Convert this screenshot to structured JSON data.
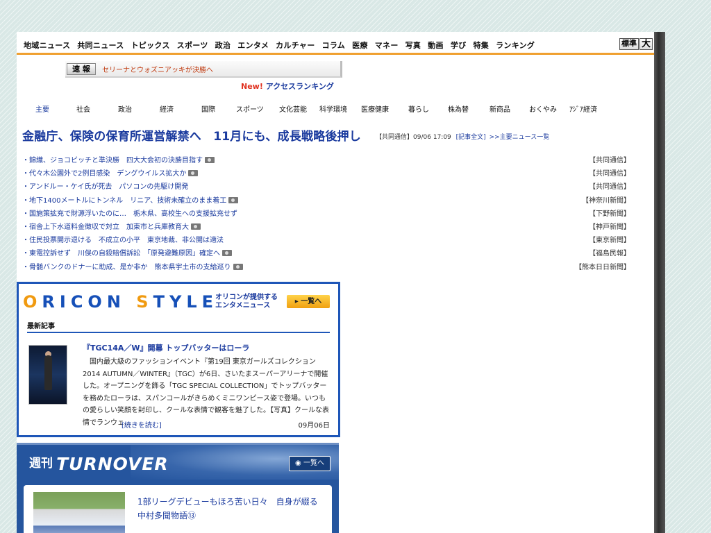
{
  "global_nav": [
    "地域ニュース",
    "共同ニュース",
    "トピックス",
    "スポーツ",
    "政治",
    "エンタメ",
    "カルチャー",
    "コラム",
    "医療",
    "マネー",
    "写真",
    "動画",
    "学び",
    "特集",
    "ランキング"
  ],
  "font_size": {
    "standard": "標準",
    "large": "大"
  },
  "breaking": {
    "label": "速 報",
    "text": "セリーナとウォズニアッキが決勝へ"
  },
  "access_ranking": {
    "new": "New!",
    "label": "アクセスランキング"
  },
  "categories": [
    "主要",
    "社会",
    "政治",
    "経済",
    "国際",
    "スポーツ",
    "文化芸能",
    "科学環境",
    "医療健康",
    "暮らし",
    "株為替",
    "新商品",
    "おくやみ",
    "ｱｼﾞｱ経済"
  ],
  "top_story": {
    "headline": "金融庁、保険の保育所運営解禁へ　11月にも、成長戦略後押し",
    "source_time": "【共同通信】09/06 17:09",
    "full_link": "[記事全文]",
    "list_link": ">>主要ニュース一覧"
  },
  "news": [
    {
      "title": "・錦織、ジョコビッチと準決勝　四大大会初の決勝目指す",
      "photo": true,
      "source": "【共同通信】"
    },
    {
      "title": "・代々木公園外で2例目感染　デングウイルス拡大か",
      "photo": true,
      "source": "【共同通信】"
    },
    {
      "title": "・アンドルー・ケイ氏が死去　パソコンの先駆け開発",
      "photo": false,
      "source": "【共同通信】"
    },
    {
      "title": "・地下1400メートルにトンネル　リニア、技術未確立のまま着工",
      "photo": true,
      "source": "【神奈川新聞】"
    },
    {
      "title": "・国施策拡充で財源浮いたのに…　栃木県、高校生への支援拡充せず",
      "photo": false,
      "source": "【下野新聞】"
    },
    {
      "title": "・宿舎上下水道料金徴収で対立　加東市と兵庫教育大",
      "photo": true,
      "source": "【神戸新聞】"
    },
    {
      "title": "・住民投票開示退ける　不成立の小平　東京地裁、非公開は適法",
      "photo": false,
      "source": "【東京新聞】"
    },
    {
      "title": "・東電控訴せず　川俣の自殺賠償訴訟　「原発避難原因」確定へ",
      "photo": true,
      "source": "【福島民報】"
    },
    {
      "title": "・骨髄バンクのドナーに助成、是か非か　熊本県宇土市の支給巡り",
      "photo": true,
      "source": "【熊本日日新聞】"
    }
  ],
  "oricon": {
    "logo": "ORICON STYLE",
    "subtitle_line1": "オリコンが提供する",
    "subtitle_line2": "エンタメニュース",
    "more": "一覧へ",
    "latest_label": "最新記事",
    "article_title": "『TGC14A／W』開幕 トップバッターはローラ",
    "article_body": "　国内最大級のファッションイベント『第19回 東京ガールズコレクション 2014 AUTUMN／WINTER』（TGC）が6日、さいたまスーパーアリーナで開催した。オープニングを飾る「TGC SPECIAL COLLECTION」でトップバッターを務めたローラは、スパンコールがきらめくミニワンピース姿で登場。いつもの愛らしい笑顔を封印し、クールな表情で観客を魅了した。【写真】クールな表情でランウェ...",
    "read_more": "[続きを読む]",
    "date": "09月06日"
  },
  "turnover": {
    "weekly": "週刊",
    "title": "TURNOVER",
    "more": "一覧へ",
    "article_title": "1部リーグデビューもほろ苦い日々　自身が綴る中村多聞物語⑬"
  },
  "colors": {
    "brand_blue": "#1a3a9e",
    "accent_orange": "#f0a030",
    "breaking_red": "#c03b10"
  }
}
